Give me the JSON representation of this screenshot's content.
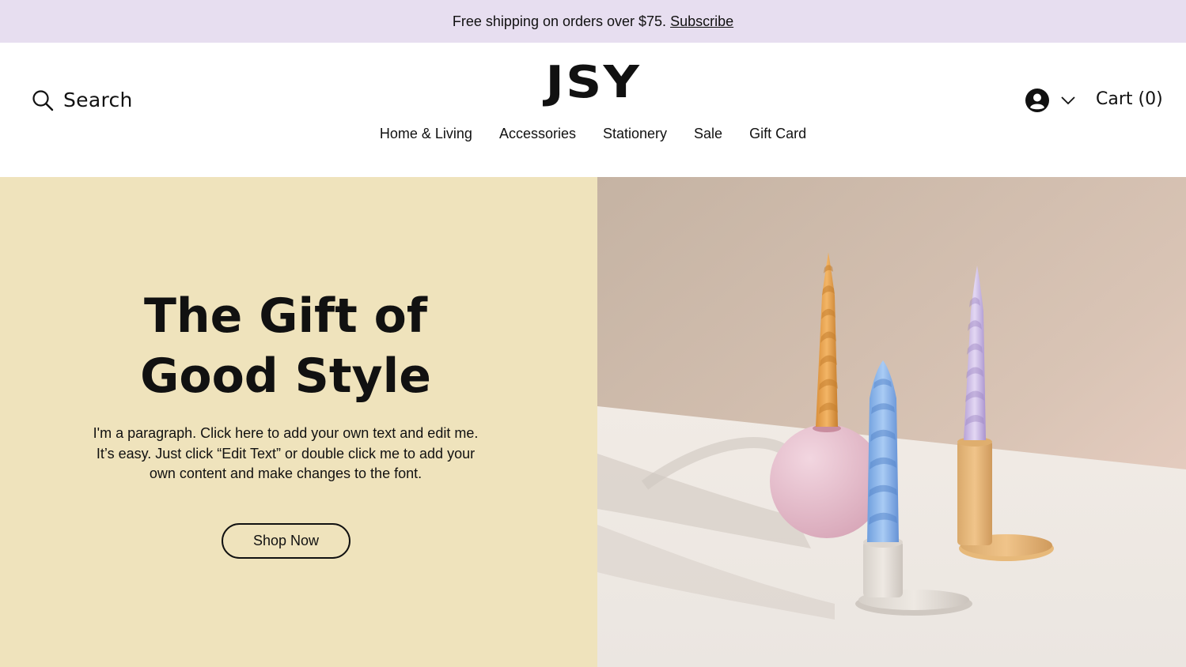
{
  "announcement": {
    "text": "Free shipping on orders over $75.",
    "link": "Subscribe"
  },
  "header": {
    "search_label": "Search",
    "logo": "JSY",
    "nav": [
      "Home & Living",
      "Accessories",
      "Stationery",
      "Sale",
      "Gift Card"
    ],
    "cart_label": "Cart (0)"
  },
  "hero": {
    "title_lines": [
      "The Gift of",
      "Good Style"
    ],
    "paragraph_lines": [
      "I'm a paragraph. Click here to add your own text and edit me.",
      "It’s easy. Just click “Edit Text” or double click me to add your",
      "own content and make changes to the font."
    ],
    "button": "Shop Now"
  },
  "colors": {
    "announcement_bg": "#e7def0",
    "hero_left_bg": "#efe3bc",
    "text": "#111111"
  }
}
